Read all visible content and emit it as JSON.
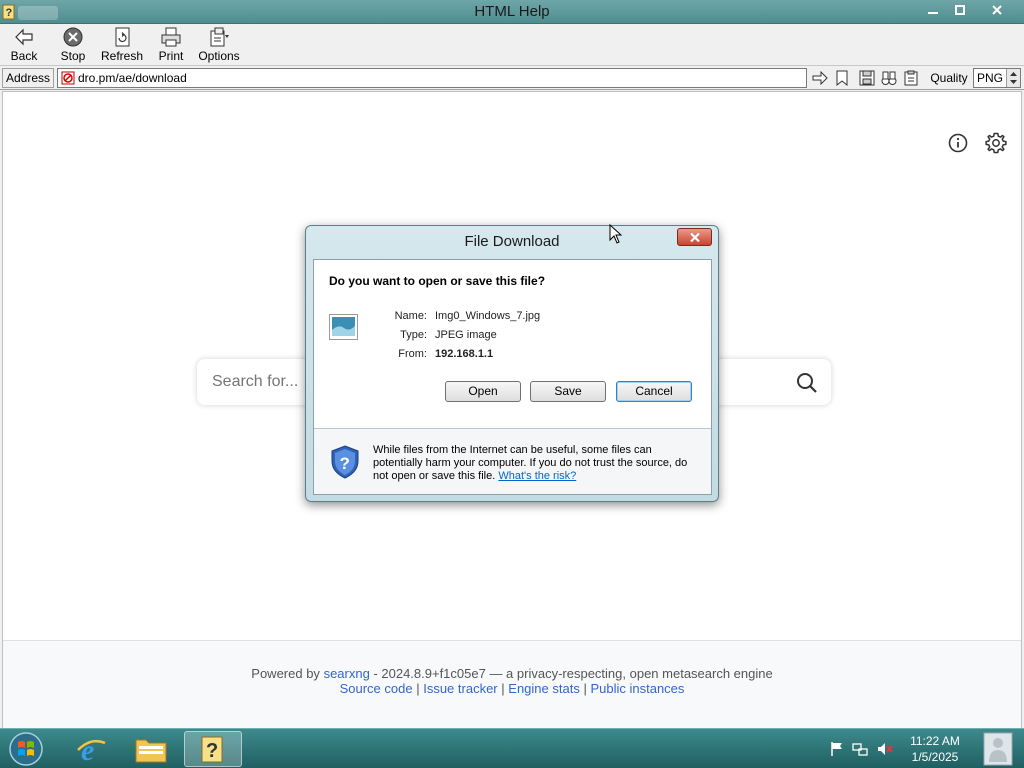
{
  "window": {
    "title": "HTML Help"
  },
  "toolbar": {
    "back_label": "Back",
    "stop_label": "Stop",
    "refresh_label": "Refresh",
    "print_label": "Print",
    "options_label": "Options"
  },
  "address": {
    "label": "Address",
    "url": "dro.pm/ae/download",
    "quality_label": "Quality",
    "quality_value": "PNG"
  },
  "page": {
    "search_placeholder": "Search for...",
    "footer_powered_by": "Powered by",
    "footer_searxng_link": "searxng",
    "footer_tagline": "- 2024.8.9+f1c05e7 — a privacy-respecting, open metasearch engine",
    "footer_links": {
      "source_code": "Source code",
      "issue_tracker": "Issue tracker",
      "engine_stats": "Engine stats",
      "public_instances": "Public instances"
    },
    "footer_separator": "|"
  },
  "dialog": {
    "title": "File Download",
    "question": "Do you want to open or save this file?",
    "name_label": "Name:",
    "name_value": "Img0_Windows_7.jpg",
    "type_label": "Type:",
    "type_value": "JPEG image",
    "from_label": "From:",
    "from_value": "192.168.1.1",
    "open_button": "Open",
    "save_button": "Save",
    "cancel_button": "Cancel",
    "warning_text": "While files from the Internet can be useful, some files can potentially harm your computer. If you do not trust the source, do not open or save this file.",
    "risk_link": "What's the risk?"
  },
  "taskbar": {
    "time": "11:22 AM",
    "date": "1/5/2025"
  },
  "colors": {
    "taskbar_teal": "#2a6f73",
    "link_blue": "#3366cc",
    "dialog_close_red": "#c9442f"
  }
}
